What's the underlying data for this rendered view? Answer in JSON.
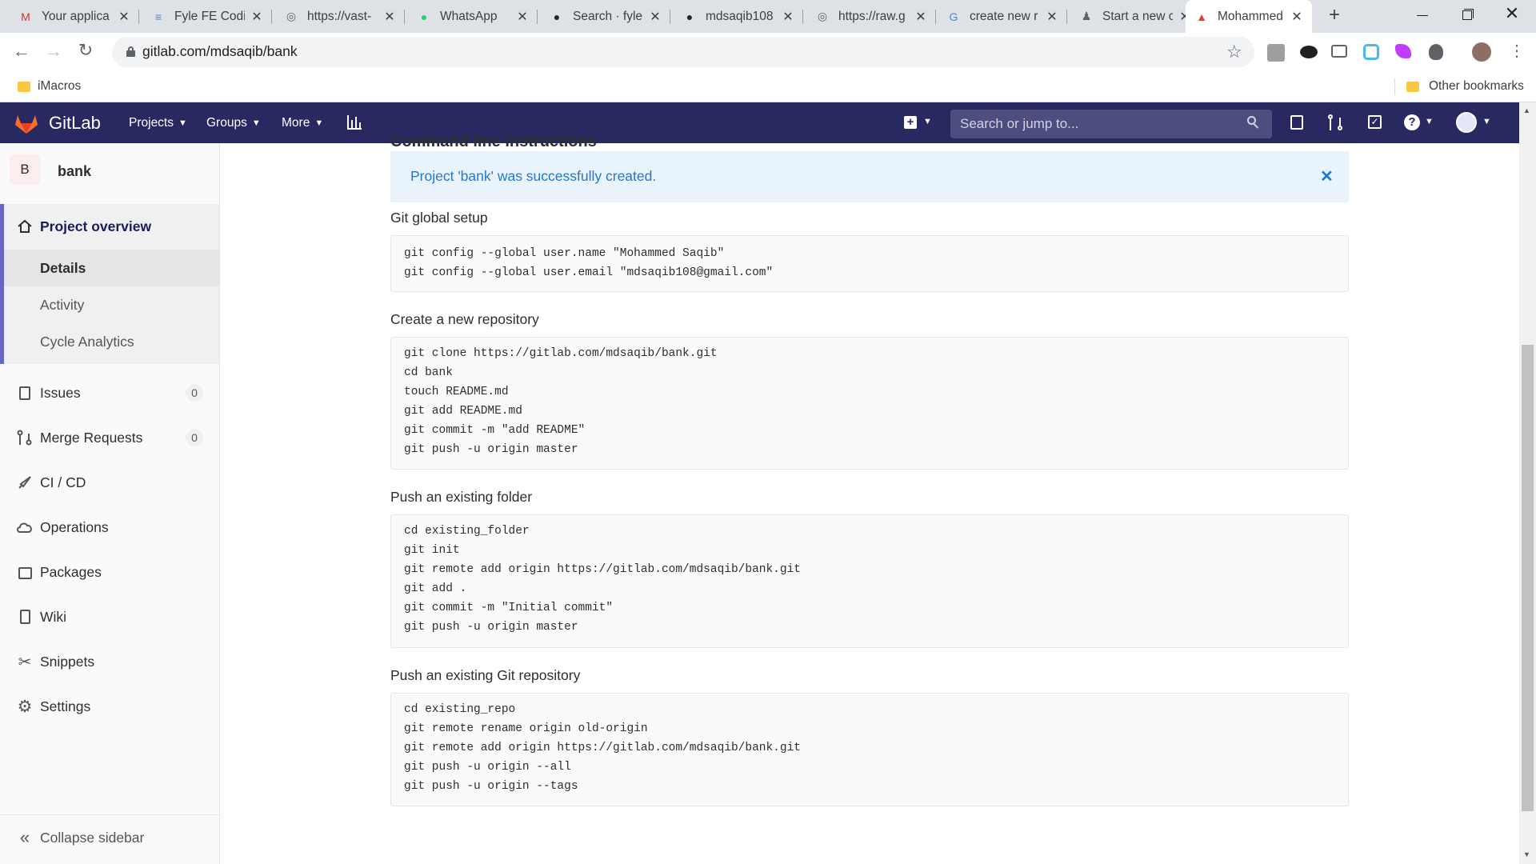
{
  "tabs": [
    {
      "title": "Your applica",
      "favicon": "gmail-icon",
      "fav_char": "M",
      "fav_color": "#d93025"
    },
    {
      "title": "Fyle FE Codi",
      "favicon": "docs-icon",
      "fav_char": "≡",
      "fav_color": "#4285f4"
    },
    {
      "title": "https://vast-",
      "favicon": "globe-icon",
      "fav_char": "◎",
      "fav_color": "#5f6368"
    },
    {
      "title": "WhatsApp",
      "favicon": "whatsapp-icon",
      "fav_char": "●",
      "fav_color": "#25d366"
    },
    {
      "title": "Search · fyle",
      "favicon": "github-icon",
      "fav_char": "●",
      "fav_color": "#24292e"
    },
    {
      "title": "mdsaqib108",
      "favicon": "github-icon",
      "fav_char": "●",
      "fav_color": "#24292e"
    },
    {
      "title": "https://raw.g",
      "favicon": "globe-icon",
      "fav_char": "◎",
      "fav_color": "#5f6368"
    },
    {
      "title": "create new r",
      "favicon": "google-icon",
      "fav_char": "G",
      "fav_color": "#4285f4"
    },
    {
      "title": "Start a new c",
      "favicon": "person-icon",
      "fav_char": "♟",
      "fav_color": "#5f6368"
    },
    {
      "title": "Mohammed",
      "favicon": "gitlab-icon",
      "fav_char": "▲",
      "fav_color": "#e24329"
    }
  ],
  "browser": {
    "url": "gitlab.com/mdsaqib/bank",
    "bookmark_folder": "iMacros",
    "other_bookmarks": "Other bookmarks"
  },
  "gitlab": {
    "brand": "GitLab",
    "nav": {
      "projects": "Projects",
      "groups": "Groups",
      "more": "More"
    },
    "search_placeholder": "Search or jump to..."
  },
  "sidebar": {
    "avatar_letter": "B",
    "project_name": "bank",
    "overview": "Project overview",
    "sub": [
      "Details",
      "Activity",
      "Cycle Analytics"
    ],
    "issues": "Issues",
    "issues_count": "0",
    "mrs": "Merge Requests",
    "mrs_count": "0",
    "cicd": "CI / CD",
    "operations": "Operations",
    "packages": "Packages",
    "wiki": "Wiki",
    "snippets": "Snippets",
    "settings": "Settings",
    "collapse": "Collapse sidebar"
  },
  "main": {
    "cut_heading": "Command line instructions",
    "flash": "Project 'bank' was successfully created.",
    "sections": [
      {
        "title": "Git global setup",
        "lines": [
          "git config --global user.name \"Mohammed Saqib\"",
          "git config --global user.email \"mdsaqib108@gmail.com\""
        ]
      },
      {
        "title": "Create a new repository",
        "lines": [
          "git clone https://gitlab.com/mdsaqib/bank.git",
          "cd bank",
          "touch README.md",
          "git add README.md",
          "git commit -m \"add README\"",
          "git push -u origin master"
        ]
      },
      {
        "title": "Push an existing folder",
        "lines": [
          "cd existing_folder",
          "git init",
          "git remote add origin https://gitlab.com/mdsaqib/bank.git",
          "git add .",
          "git commit -m \"Initial commit\"",
          "git push -u origin master"
        ]
      },
      {
        "title": "Push an existing Git repository",
        "lines": [
          "cd existing_repo",
          "git remote rename origin old-origin",
          "git remote add origin https://gitlab.com/mdsaqib/bank.git",
          "git push -u origin --all",
          "git push -u origin --tags"
        ]
      }
    ]
  },
  "colors": {
    "header": "#292961",
    "flash_bg": "#e9f3fc",
    "flash_text": "#1f78d1",
    "active_bar": "#6666c4"
  }
}
